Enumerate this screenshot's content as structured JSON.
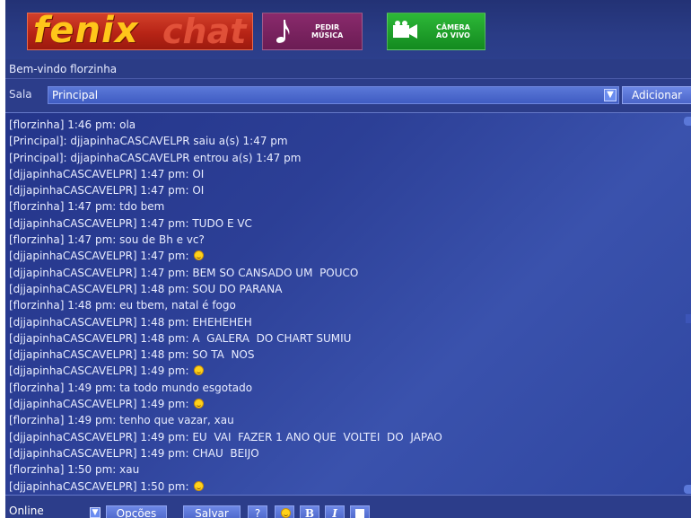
{
  "header": {
    "logo_main": "fenix",
    "logo_sub": "chat",
    "request_music": "PEDIR\nMÚSICA",
    "live_camera": "CÂMERA\nAO VIVO"
  },
  "welcome": "Bem-vindo florzinha",
  "room": {
    "label": "Sala",
    "selected": "Principal",
    "add_button": "Adicionar"
  },
  "messages": [
    {
      "text": "[florzinha] 1:46 pm: ola",
      "smiley": false
    },
    {
      "text": "[Principal]: djjapinhaCASCAVELPR saiu a(s) 1:47 pm",
      "smiley": false
    },
    {
      "text": "[Principal]: djjapinhaCASCAVELPR entrou a(s) 1:47 pm",
      "smiley": false
    },
    {
      "text": "[djjapinhaCASCAVELPR] 1:47 pm: OI",
      "smiley": false
    },
    {
      "text": "[djjapinhaCASCAVELPR] 1:47 pm: OI",
      "smiley": false
    },
    {
      "text": "[florzinha] 1:47 pm: tdo bem",
      "smiley": false
    },
    {
      "text": "[djjapinhaCASCAVELPR] 1:47 pm: TUDO E VC",
      "smiley": false
    },
    {
      "text": "[florzinha] 1:47 pm: sou de Bh e vc?",
      "smiley": false
    },
    {
      "text": "[djjapinhaCASCAVELPR] 1:47 pm: ",
      "smiley": true
    },
    {
      "text": "[djjapinhaCASCAVELPR] 1:47 pm: BEM SO CANSADO UM  POUCO",
      "smiley": false
    },
    {
      "text": "[djjapinhaCASCAVELPR] 1:48 pm: SOU DO PARANA",
      "smiley": false
    },
    {
      "text": "[florzinha] 1:48 pm: eu tbem, natal é fogo",
      "smiley": false
    },
    {
      "text": "[djjapinhaCASCAVELPR] 1:48 pm: EHEHEHEH",
      "smiley": false
    },
    {
      "text": "[djjapinhaCASCAVELPR] 1:48 pm: A  GALERA  DO CHART SUMIU",
      "smiley": false
    },
    {
      "text": "[djjapinhaCASCAVELPR] 1:48 pm: SO TA  NOS",
      "smiley": false
    },
    {
      "text": "[djjapinhaCASCAVELPR] 1:49 pm: ",
      "smiley": true
    },
    {
      "text": "[florzinha] 1:49 pm: ta todo mundo esgotado",
      "smiley": false
    },
    {
      "text": "[djjapinhaCASCAVELPR] 1:49 pm: ",
      "smiley": true
    },
    {
      "text": "[florzinha] 1:49 pm: tenho que vazar, xau",
      "smiley": false
    },
    {
      "text": "[djjapinhaCASCAVELPR] 1:49 pm: EU  VAI  FAZER 1 ANO QUE  VOLTEI  DO  JAPAO",
      "smiley": false
    },
    {
      "text": "[djjapinhaCASCAVELPR] 1:49 pm: CHAU  BEIJO",
      "smiley": false
    },
    {
      "text": "[florzinha] 1:50 pm: xau",
      "smiley": false
    },
    {
      "text": "[djjapinhaCASCAVELPR] 1:50 pm: ",
      "smiley": true
    }
  ],
  "toolbar": {
    "status": "Online",
    "options": "Opções",
    "save": "Salvar",
    "help": "?",
    "bold": "B",
    "italic": "I"
  }
}
